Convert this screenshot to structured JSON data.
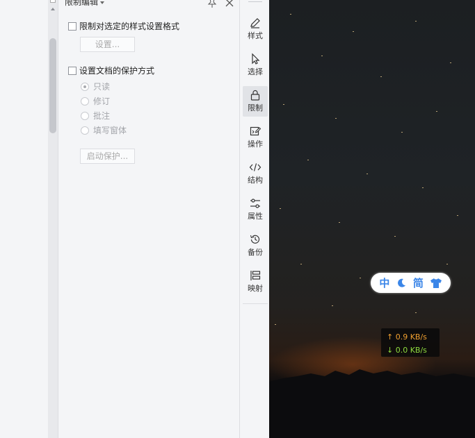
{
  "panel": {
    "title": "限制编辑",
    "format_restriction": {
      "label": "限制对选定的样式设置格式",
      "checked": false,
      "settings_button": "设置..."
    },
    "protection": {
      "label": "设置文档的保护方式",
      "checked": false,
      "options": [
        {
          "label": "只读",
          "selected": true
        },
        {
          "label": "修订",
          "selected": false
        },
        {
          "label": "批注",
          "selected": false
        },
        {
          "label": "填写窗体",
          "selected": false
        }
      ],
      "start_button": "启动保护..."
    }
  },
  "toolbar": {
    "items": [
      {
        "label": "样式",
        "icon": "pen-icon",
        "active": false
      },
      {
        "label": "选择",
        "icon": "cursor-icon",
        "active": false
      },
      {
        "label": "限制",
        "icon": "lock-icon",
        "active": true
      },
      {
        "label": "操作",
        "icon": "edit-image-icon",
        "active": false
      },
      {
        "label": "结构",
        "icon": "code-icon",
        "active": false
      },
      {
        "label": "属性",
        "icon": "sliders-icon",
        "active": false
      },
      {
        "label": "备份",
        "icon": "history-icon",
        "active": false
      },
      {
        "label": "映射",
        "icon": "mapping-icon",
        "active": false
      }
    ]
  },
  "ime": {
    "mode": "中",
    "charset": "简"
  },
  "network": {
    "upload": "↑ 0.9 KB/s",
    "download": "↓ 0.0 KB/s"
  },
  "colors": {
    "accent": "#3b86e8",
    "upload": "#f0a030",
    "download": "#8fdc3f"
  }
}
